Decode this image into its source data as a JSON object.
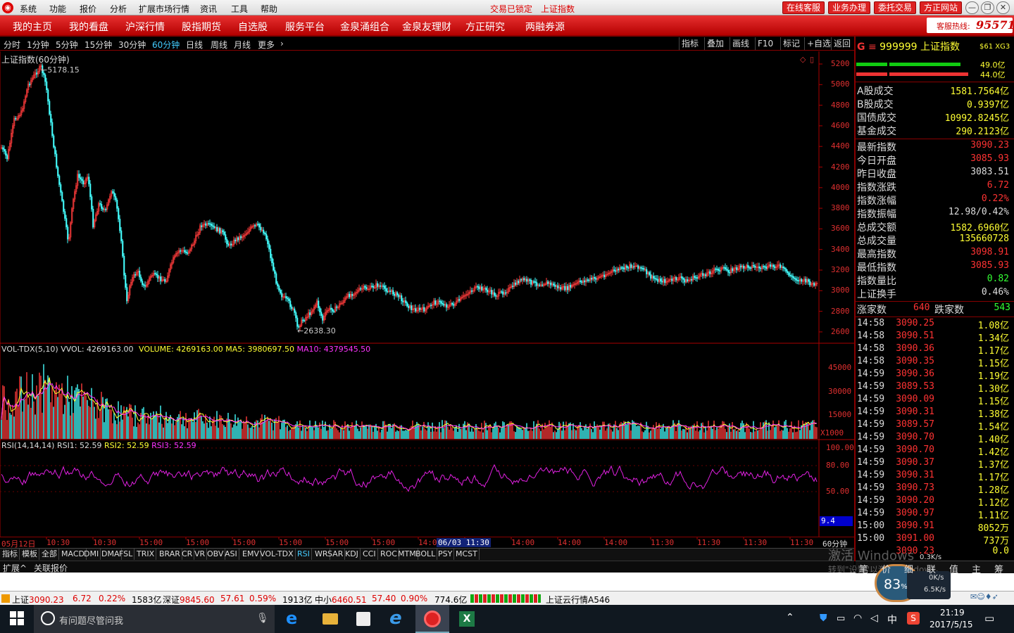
{
  "titlebar": {
    "menus": [
      "系统",
      "功能",
      "报价",
      "分析",
      "扩展市场行情",
      "资讯",
      "工具",
      "帮助"
    ],
    "status": "交易已锁定",
    "center_title": "上证指数",
    "buttons": [
      "在线客服",
      "业务办理",
      "委托交易",
      "方正网站"
    ]
  },
  "navbar": {
    "items": [
      "我的主页",
      "我的看盘",
      "沪深行情",
      "股指期货",
      "自选股",
      "服务平台",
      "金泉涌组合",
      "金泉友理财",
      "方正研究",
      "两融券源"
    ],
    "hotline_label": "客服热线:",
    "hotline": "95571"
  },
  "periods": {
    "items": [
      "分时",
      "1分钟",
      "5分钟",
      "15分钟",
      "30分钟",
      "60分钟",
      "日线",
      "周线",
      "月线",
      "更多"
    ],
    "active_index": 5,
    "tools": [
      "指标",
      "叠加",
      "画线",
      "F10",
      "标记",
      "+自选",
      "返回"
    ]
  },
  "main_chart": {
    "title": "上证指数(60分钟)",
    "high_label": "5178.15",
    "low_label": "2638.30",
    "y_ticks": [
      "5200",
      "5000",
      "4800",
      "4600",
      "4400",
      "4200",
      "4000",
      "3800",
      "3600",
      "3400",
      "3200",
      "3000",
      "2800",
      "2600"
    ]
  },
  "volume_chart": {
    "name": "VOL-TDX(5,10)",
    "vvol": "VVOL: 4269163.00",
    "volume": "VOLUME: 4269163.00",
    "ma5": "MA5: 3980697.50",
    "ma10": "MA10: 4379545.50",
    "y_ticks": [
      "45000",
      "30000",
      "15000"
    ],
    "unit": "X1000"
  },
  "rsi_chart": {
    "name": "RSI(14,14,14)",
    "rsi1": "RSI1: 52.59",
    "rsi2": "RSI2: 52.59",
    "rsi3": "RSI3: 52.59",
    "y_ticks": [
      "100.00",
      "80.00",
      "50.00"
    ],
    "current": "9.4"
  },
  "x_axis": {
    "labels": [
      "05月12日",
      "10:30",
      "10:30",
      "15:00",
      "15:00",
      "15:00",
      "15:00",
      "15:00",
      "15:00",
      "14:00",
      "06/03 11:30",
      "14:00",
      "14:00",
      "14:00",
      "11:30",
      "11:30",
      "11:30",
      "11:30"
    ],
    "period": "60分钟"
  },
  "indicator_tabs": [
    "指标",
    "模板",
    "全部",
    "MACD",
    "DMI",
    "DMA",
    "FSL",
    "TRIX",
    "BRAR",
    "CR",
    "VR",
    "OBV",
    "ASI",
    "EMV",
    "VOL-TDX",
    "RSI",
    "WR",
    "SAR",
    "KDJ",
    "CCI",
    "ROC",
    "MTM",
    "BOLL",
    "PSY",
    "MCST"
  ],
  "bottom_tabs": [
    "扩展^",
    "关联报价"
  ],
  "right_panel": {
    "code": "999999",
    "name": "上证指数",
    "tag": "$61 XG3",
    "bar_top": "49.0亿",
    "bar_bottom": "44.0亿",
    "turnover": [
      {
        "label": "A股成交",
        "value": "1581.7564亿"
      },
      {
        "label": "B股成交",
        "value": "0.9397亿"
      },
      {
        "label": "国债成交",
        "value": "10992.8245亿"
      },
      {
        "label": "基金成交",
        "value": "290.2123亿"
      }
    ],
    "stats": [
      {
        "label": "最新指数",
        "value": "3090.23",
        "color": "#ff3333"
      },
      {
        "label": "今日开盘",
        "value": "3085.93",
        "color": "#ff3333"
      },
      {
        "label": "昨日收盘",
        "value": "3083.51",
        "color": "#dddddd"
      },
      {
        "label": "指数涨跌",
        "value": "6.72",
        "color": "#ff3333"
      },
      {
        "label": "指数涨幅",
        "value": "0.22%",
        "color": "#ff3333"
      },
      {
        "label": "指数振幅",
        "value": "12.98/0.42%",
        "color": "#dddddd"
      },
      {
        "label": "总成交额",
        "value": "1582.6960亿",
        "color": "#ffff33"
      },
      {
        "label": "总成交量",
        "value": "135660728",
        "color": "#ffff33"
      },
      {
        "label": "最高指数",
        "value": "3098.91",
        "color": "#ff3333"
      },
      {
        "label": "最低指数",
        "value": "3085.93",
        "color": "#ff3333"
      },
      {
        "label": "指数量比",
        "value": "0.82",
        "color": "#33ff33"
      },
      {
        "label": "上证换手",
        "value": "0.46%",
        "color": "#dddddd"
      }
    ],
    "up_label": "涨家数",
    "up_count": "640",
    "down_label": "跌家数",
    "down_count": "543",
    "ticks": [
      {
        "t": "14:58",
        "p": "3090.25",
        "v": "1.08亿"
      },
      {
        "t": "14:58",
        "p": "3090.51",
        "v": "1.34亿"
      },
      {
        "t": "14:58",
        "p": "3090.36",
        "v": "1.17亿"
      },
      {
        "t": "14:58",
        "p": "3090.35",
        "v": "1.15亿"
      },
      {
        "t": "14:59",
        "p": "3090.36",
        "v": "1.19亿"
      },
      {
        "t": "14:59",
        "p": "3089.53",
        "v": "1.30亿"
      },
      {
        "t": "14:59",
        "p": "3090.09",
        "v": "1.15亿"
      },
      {
        "t": "14:59",
        "p": "3090.31",
        "v": "1.38亿"
      },
      {
        "t": "14:59",
        "p": "3089.57",
        "v": "1.54亿"
      },
      {
        "t": "14:59",
        "p": "3090.70",
        "v": "1.40亿"
      },
      {
        "t": "14:59",
        "p": "3090.70",
        "v": "1.42亿"
      },
      {
        "t": "14:59",
        "p": "3090.37",
        "v": "1.37亿"
      },
      {
        "t": "14:59",
        "p": "3090.31",
        "v": "1.17亿"
      },
      {
        "t": "14:59",
        "p": "3090.73",
        "v": "1.28亿"
      },
      {
        "t": "14:59",
        "p": "3090.20",
        "v": "1.12亿"
      },
      {
        "t": "14:59",
        "p": "3090.97",
        "v": "1.11亿"
      },
      {
        "t": "15:00",
        "p": "3090.91",
        "v": "8052万"
      },
      {
        "t": "15:00",
        "p": "3091.00",
        "v": "737万"
      },
      {
        "t": "",
        "p": "3090.23",
        "v": "0.0"
      }
    ],
    "bottom_tabs": [
      "笔",
      "价",
      "细",
      "联",
      "值",
      "主",
      "筹"
    ]
  },
  "status_bar": {
    "sh_label": "上证",
    "sh_val": "3090.23",
    "sh_chg": "6.72",
    "sh_pct": "0.22%",
    "sh_amt": "1583亿",
    "sz_label": "深证",
    "sz_val": "9845.60",
    "sz_chg": "57.61",
    "sz_pct": "0.59%",
    "sz_amt": "1913亿",
    "zx_label": "中小",
    "zx_val": "6460.51",
    "zx_chg": "57.40",
    "zx_pct": "0.90%",
    "zx_amt": "774.6亿",
    "server": "上证云行情A546"
  },
  "watermark": {
    "line1": "激活 Windows",
    "line2": "转到\"设置\"以激活 Windows。"
  },
  "net_widget": {
    "percent": "83",
    "unit": "%",
    "up": "0.3K/s",
    "down1": "0K/s",
    "down2": "6.5K/s"
  },
  "taskbar": {
    "search_placeholder": "有问题尽管问我",
    "time": "21:19",
    "date": "2017/5/15",
    "ime": "中"
  }
}
